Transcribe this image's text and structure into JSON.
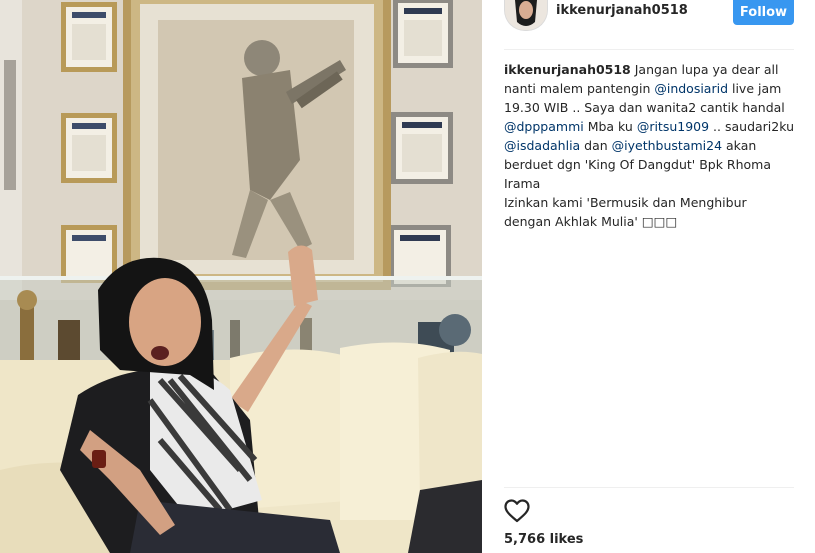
{
  "post": {
    "username": "ikkenurjanah0518",
    "follow_label": "Follow",
    "caption": [
      {
        "text": "ikkenurjanah0518",
        "kind": "user"
      },
      {
        "text": " Jangan lupa ya dear all nanti malem pantengin ",
        "kind": "text"
      },
      {
        "text": "@indosiarid",
        "kind": "mention"
      },
      {
        "text": " live jam 19.30 WIB .. Saya dan wanita2 cantik handal ",
        "kind": "text"
      },
      {
        "text": "@dpppammi",
        "kind": "mention"
      },
      {
        "text": " Mba ku ",
        "kind": "text"
      },
      {
        "text": "@ritsu1909",
        "kind": "mention"
      },
      {
        "text": " .. saudari2ku ",
        "kind": "text"
      },
      {
        "text": "@isdadahlia",
        "kind": "mention"
      },
      {
        "text": " dan ",
        "kind": "text"
      },
      {
        "text": "@iyethbustami24",
        "kind": "mention"
      },
      {
        "text": " akan berduet dgn 'King Of Dangdut' Bpk Rhoma Irama\nIzinkan kami 'Bermusik dan Menghibur dengan Akhlak Mulia' □□□",
        "kind": "text"
      }
    ],
    "likes": "5,766 likes"
  },
  "icons": {
    "like": "heart-outline-icon"
  },
  "colors": {
    "follow_button": "#3897f0",
    "mention": "#003569",
    "text": "#262626",
    "divider": "#efefef"
  }
}
